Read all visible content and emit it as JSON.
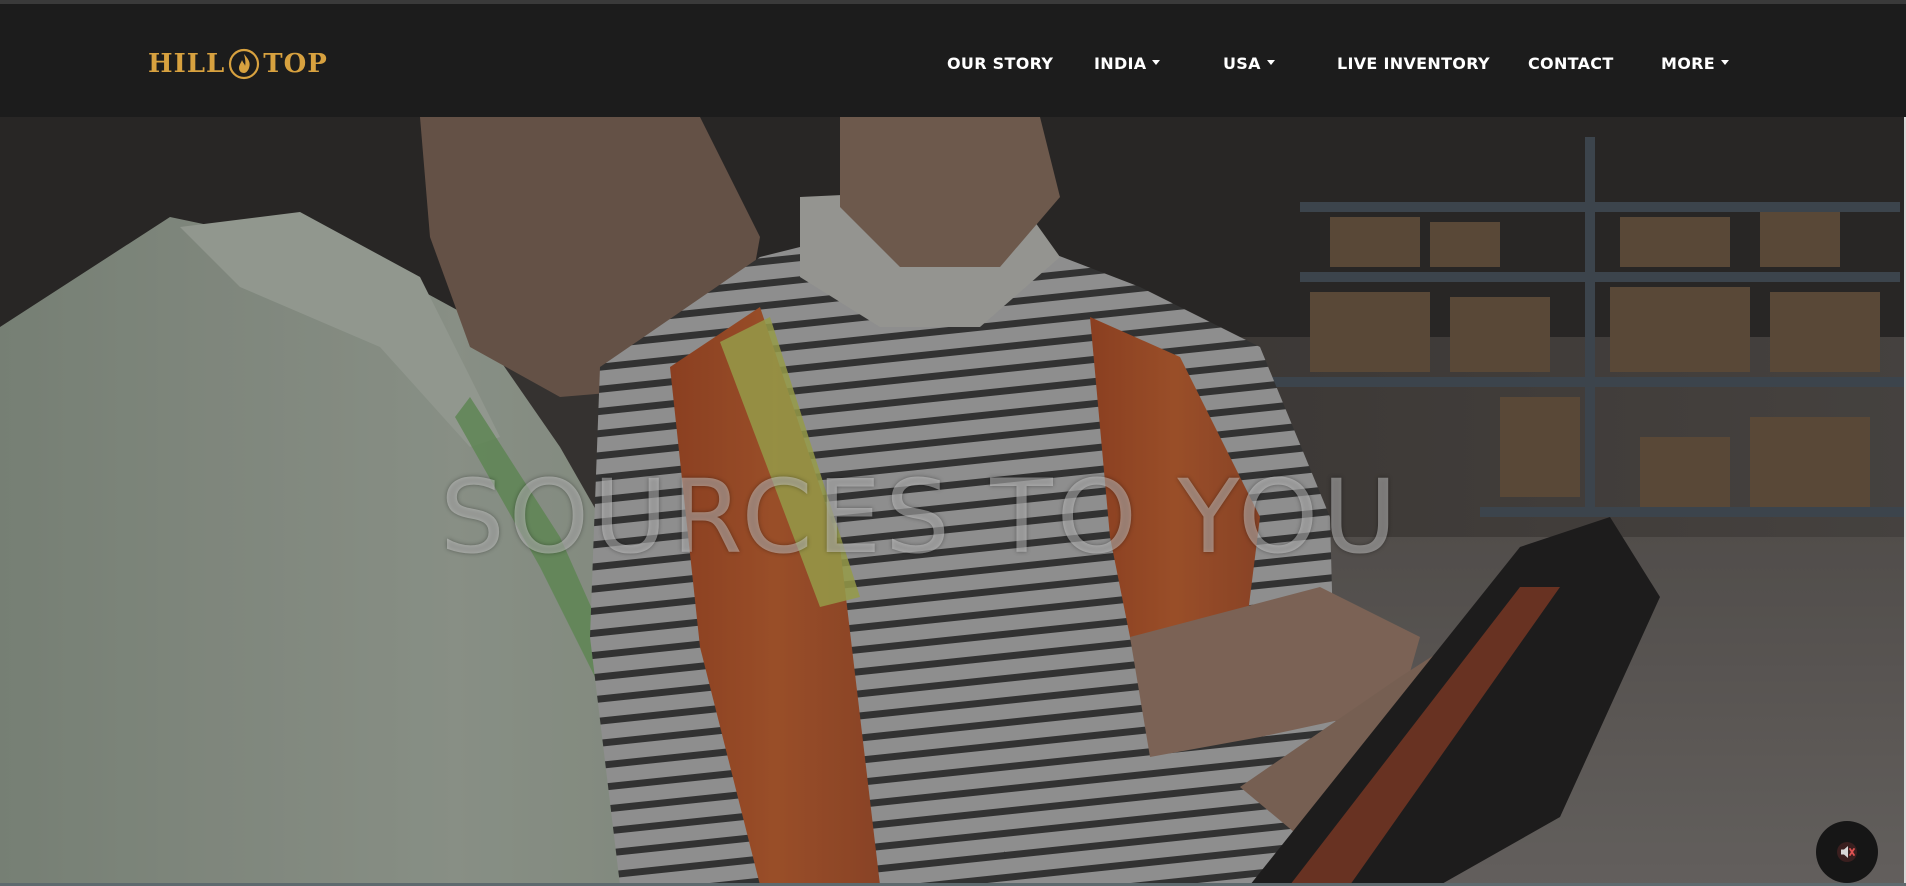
{
  "brand": {
    "logo_left": "HILL",
    "logo_right": "TOP",
    "logo_color": "#d7a13f"
  },
  "nav": {
    "items": [
      {
        "label": "OUR STORY",
        "has_dropdown": false
      },
      {
        "label": "INDIA",
        "has_dropdown": true
      },
      {
        "label": "USA",
        "has_dropdown": true
      },
      {
        "label": "LIVE INVENTORY",
        "has_dropdown": false
      },
      {
        "label": "CONTACT",
        "has_dropdown": false
      },
      {
        "label": "MORE",
        "has_dropdown": true
      }
    ]
  },
  "hero": {
    "headline": "SOURCES TO YOU",
    "mute_icon": "speaker-muted-icon"
  },
  "colors": {
    "nav_background": "#1c1c1c",
    "nav_text": "#ffffff",
    "vest_orange": "#e8652a"
  }
}
